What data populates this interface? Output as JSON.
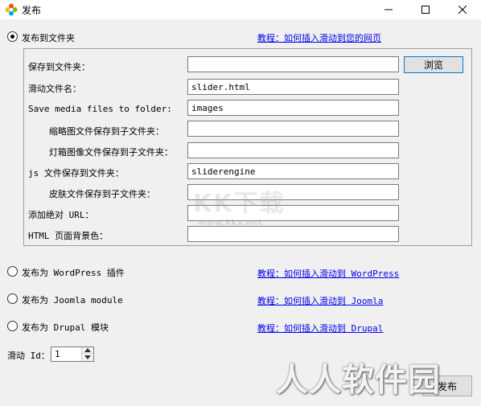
{
  "window": {
    "title": "发布"
  },
  "publish_folder": {
    "label": "发布到文件夹",
    "selected": true,
    "tutorial_link": "教程：如何插入滑动到您的网页",
    "fields": [
      {
        "label": "保存到文件夹：",
        "value": ""
      },
      {
        "label": "滑动文件名：",
        "value": "slider.html"
      },
      {
        "label": "Save media files to folder:",
        "value": "images"
      },
      {
        "label": "缩略图文件保存到子文件夹：",
        "value": ""
      },
      {
        "label": "灯箱图像文件保存到子文件夹：",
        "value": ""
      },
      {
        "label": "js 文件保存到文件夹：",
        "value": "sliderengine"
      },
      {
        "label": "皮肤文件保存到子文件夹：",
        "value": ""
      },
      {
        "label": "添加绝对 URL：",
        "value": ""
      },
      {
        "label": "HTML 页面背景色：",
        "value": ""
      }
    ],
    "browse_label": "浏览"
  },
  "publish_wordpress": {
    "label": "发布为 WordPress 插件",
    "tutorial_link": "教程：如何插入滑动到 WordPress"
  },
  "publish_joomla": {
    "label": "发布为 Joomla module",
    "tutorial_link": "教程：如何插入滑动到 Joomla"
  },
  "publish_drupal": {
    "label": "发布为 Drupal 模块",
    "tutorial_link": "教程：如何插入滑动到 Drupal"
  },
  "slider_id": {
    "label": "滑动 Id：",
    "value": "1"
  },
  "footer": {
    "corner_button": "发布"
  },
  "watermarks": {
    "main": "人人软件园",
    "logo": "KK下载",
    "url": "www.kkx.net"
  }
}
